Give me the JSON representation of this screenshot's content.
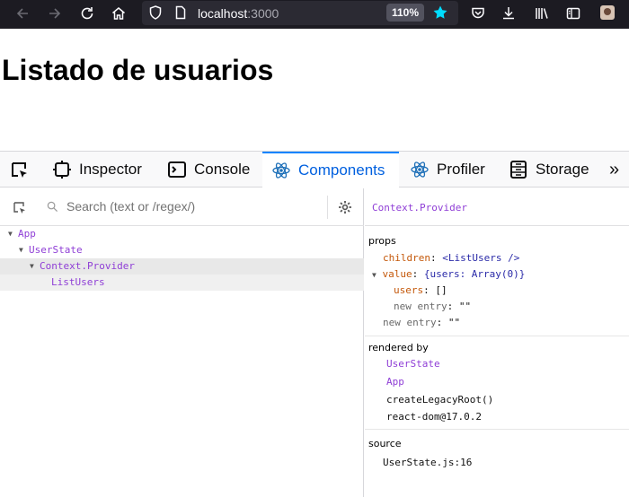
{
  "browser": {
    "url_host": "localhost",
    "url_port": ":3000",
    "zoom": "110%"
  },
  "page": {
    "title": "Listado de usuarios"
  },
  "devtools": {
    "tabs": [
      {
        "label": "Inspector",
        "icon": "inspector-icon"
      },
      {
        "label": "Console",
        "icon": "console-icon"
      },
      {
        "label": "Components",
        "icon": "react-icon"
      },
      {
        "label": "Profiler",
        "icon": "react-icon"
      },
      {
        "label": "Storage",
        "icon": "storage-icon"
      }
    ],
    "active_tab": "Components",
    "search_placeholder": "Search (text or /regex/)",
    "tree": [
      {
        "label": "App",
        "depth": 0
      },
      {
        "label": "UserState",
        "depth": 1
      },
      {
        "label": "Context.Provider",
        "depth": 2
      },
      {
        "label": "ListUsers",
        "depth": 3
      }
    ],
    "selected": "Context.Provider",
    "props": {
      "section": "props",
      "children_key": "children",
      "children_val": "<ListUsers />",
      "value_key": "value",
      "value_val": "{users: Array(0)}",
      "users_key": "users",
      "users_val": "[]",
      "new_entry_key": "new entry",
      "new_entry_val": "\"\""
    },
    "rendered_by": {
      "section": "rendered by",
      "items": [
        "UserState",
        "App",
        "createLegacyRoot()",
        "react-dom@17.0.2"
      ]
    },
    "source": {
      "section": "source",
      "file": "UserState.js:16"
    }
  }
}
